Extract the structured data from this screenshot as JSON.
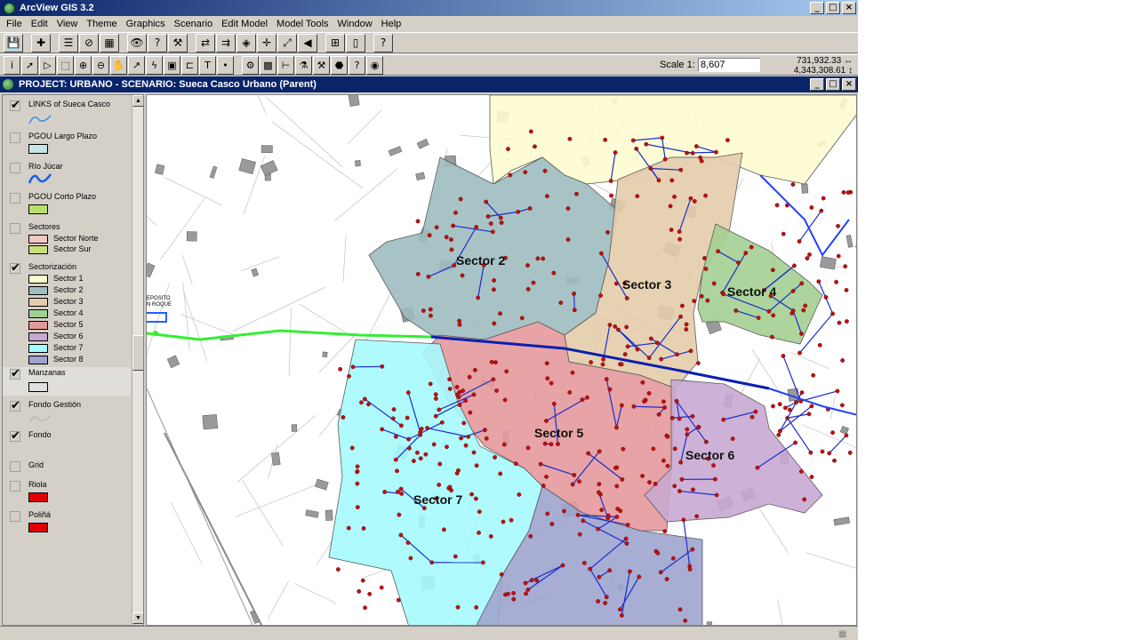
{
  "app": {
    "title": "ArcView GIS 3.2"
  },
  "window_controls": {
    "minimize": "_",
    "maximize": "□",
    "close": "×"
  },
  "menu": [
    "File",
    "Edit",
    "View",
    "Theme",
    "Graphics",
    "Scenario",
    "Edit Model",
    "Model Tools",
    "Window",
    "Help"
  ],
  "toolbar1": [
    {
      "name": "save-button",
      "icon": "💾"
    },
    {
      "name": "add-theme-button",
      "icon": "✚"
    },
    {
      "name": "theme-properties-button",
      "icon": "☰"
    },
    {
      "name": "edit-legend-button",
      "icon": "⊘"
    },
    {
      "name": "open-table-button",
      "icon": "▦"
    },
    {
      "name": "find-button",
      "icon": "👁"
    },
    {
      "name": "query-builder-button",
      "icon": "?"
    },
    {
      "name": "locate-address-button",
      "icon": "⚒"
    },
    {
      "name": "zoom-full-button",
      "icon": "⇄"
    },
    {
      "name": "zoom-active-button",
      "icon": "⇉"
    },
    {
      "name": "zoom-selected-button",
      "icon": "◈"
    },
    {
      "name": "zoom-in-button",
      "icon": "✛"
    },
    {
      "name": "zoom-out-button",
      "icon": "⤢"
    },
    {
      "name": "zoom-previous-button",
      "icon": "◀"
    },
    {
      "name": "select-features-button",
      "icon": "⊞"
    },
    {
      "name": "clear-selection-button",
      "icon": "▯"
    },
    {
      "name": "help-button",
      "icon": "?"
    }
  ],
  "toolbar2": [
    {
      "name": "identify-tool",
      "icon": "i"
    },
    {
      "name": "pointer-tool",
      "icon": "➚"
    },
    {
      "name": "vertex-edit-tool",
      "icon": "▷"
    },
    {
      "name": "select-feature-tool",
      "icon": "⬚"
    },
    {
      "name": "zoom-in-tool",
      "icon": "⊕"
    },
    {
      "name": "zoom-out-tool",
      "icon": "⊖"
    },
    {
      "name": "pan-tool",
      "icon": "✋"
    },
    {
      "name": "measure-tool",
      "icon": "↗"
    },
    {
      "name": "hotlink-tool",
      "icon": "ϟ"
    },
    {
      "name": "area-tool",
      "icon": "▣"
    },
    {
      "name": "label-tool",
      "icon": "⊏"
    },
    {
      "name": "text-tool",
      "icon": "T"
    },
    {
      "name": "draw-point-tool",
      "icon": "•"
    },
    {
      "name": "network-tool",
      "icon": "⚙"
    },
    {
      "name": "grid-tool",
      "icon": "▩"
    },
    {
      "name": "valve-tool",
      "icon": "⊢"
    },
    {
      "name": "model-tool",
      "icon": "⚗"
    },
    {
      "name": "pipe-tool",
      "icon": "⚒"
    },
    {
      "name": "tank-tool",
      "icon": "⬣"
    },
    {
      "name": "info-tool",
      "icon": "?"
    },
    {
      "name": "globe-tool",
      "icon": "◉"
    }
  ],
  "scale": {
    "label": "Scale 1:",
    "value": "8,607"
  },
  "coordinates": {
    "x": "731,932.33",
    "y": "4,343,308.61"
  },
  "document": {
    "title": "PROJECT: URBANO - SCENARIO: Sueca Casco Urbano (Parent)"
  },
  "toc": {
    "themes": [
      {
        "name": "LINKS of Sueca Casco",
        "checked": true
      },
      {
        "name": "PGOU Largo Plazo",
        "checked": false
      },
      {
        "name": "Río Júcar",
        "checked": false
      },
      {
        "name": "PGOU Corto Plazo",
        "checked": false
      },
      {
        "name": "Sectores",
        "checked": false,
        "classes": [
          "Sector Norte",
          "Sector Sur"
        ]
      },
      {
        "name": "Sectorización",
        "checked": true,
        "classes": [
          "Sector 1",
          "Sector 2",
          "Sector 3",
          "Sector 4",
          "Sector 5",
          "Sector 6",
          "Sector 7",
          "Sector 8"
        ]
      },
      {
        "name": "Manzanas",
        "checked": true
      },
      {
        "name": "Fondo Gestión",
        "checked": true
      },
      {
        "name": "Fondo",
        "checked": true
      },
      {
        "name": "Grid",
        "checked": false
      },
      {
        "name": "Riola",
        "checked": false
      },
      {
        "name": "Poliñá",
        "checked": false
      }
    ],
    "check_mark": "✔"
  },
  "colors": {
    "sector_norte": "#f4c7c3",
    "sector_sur": "#c8e07a",
    "sector1": "#fdfcd0",
    "sector2": "#9fbcbf",
    "sector3": "#e4ccab",
    "sector4": "#a3cf91",
    "sector5": "#e4999c",
    "sector6": "#c9a8d1",
    "sector7": "#a6f9fd",
    "sector8": "#9ea4cf",
    "pgou_largo": "#c8e4e6",
    "pgou_corto": "#b7e06a",
    "manzanas": "#e0e0e0",
    "riola": "#e00000",
    "polina": "#e00000",
    "pipe_blue": "#1a2ecc",
    "node_red": "#c01010",
    "main_green": "#33ee33"
  },
  "map": {
    "labels": [
      "Sector 2",
      "Sector 3",
      "Sector 4",
      "Sector 5",
      "Sector 6",
      "Sector 7"
    ],
    "deposito": "EPOSITO\nN ROQUE"
  }
}
